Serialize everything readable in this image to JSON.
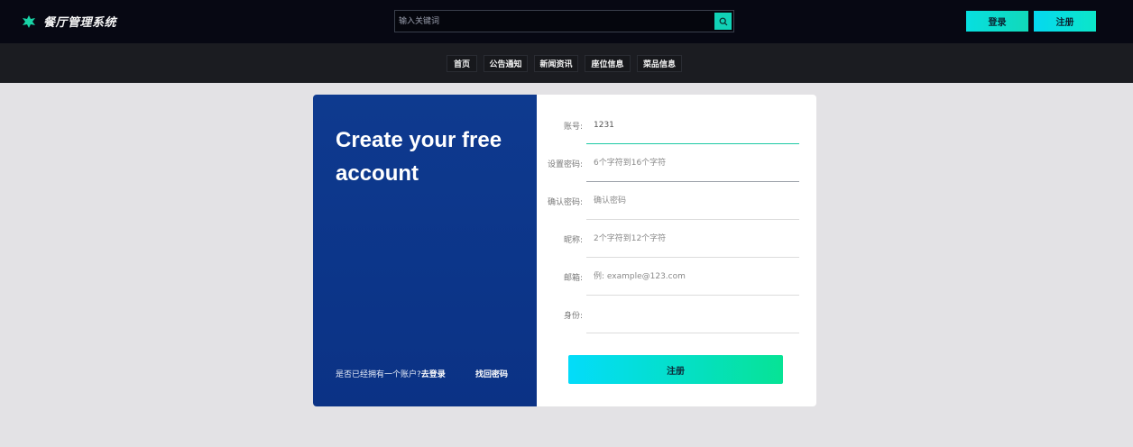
{
  "header": {
    "app_title": "餐厅管理系统",
    "search_placeholder": "输入关键词",
    "login_label": "登录",
    "register_label": "注册"
  },
  "nav": {
    "items": [
      "首页",
      "公告通知",
      "新闻资讯",
      "座位信息",
      "菜品信息"
    ]
  },
  "register_card": {
    "title": "Create your free account",
    "has_account_text": "是否已经拥有一个账户?",
    "go_login_label": "去登录",
    "find_password_label": "找回密码",
    "fields": [
      {
        "label": "账号:",
        "value": "1231",
        "placeholder": ""
      },
      {
        "label": "设置密码:",
        "value": "",
        "placeholder": "6个字符到16个字符"
      },
      {
        "label": "确认密码:",
        "value": "",
        "placeholder": "确认密码"
      },
      {
        "label": "昵称:",
        "value": "",
        "placeholder": "2个字符到12个字符"
      },
      {
        "label": "邮箱:",
        "value": "",
        "placeholder": "例: example@123.com"
      },
      {
        "label": "身份:",
        "value": "",
        "placeholder": ""
      }
    ],
    "submit_label": "注册"
  },
  "colors": {
    "accent": "#11d9b9",
    "topbar_bg": "#070813",
    "navbar_bg": "#1b1c21",
    "panel_blue": "#0e3a8f",
    "page_bg": "#e3e2e5"
  }
}
